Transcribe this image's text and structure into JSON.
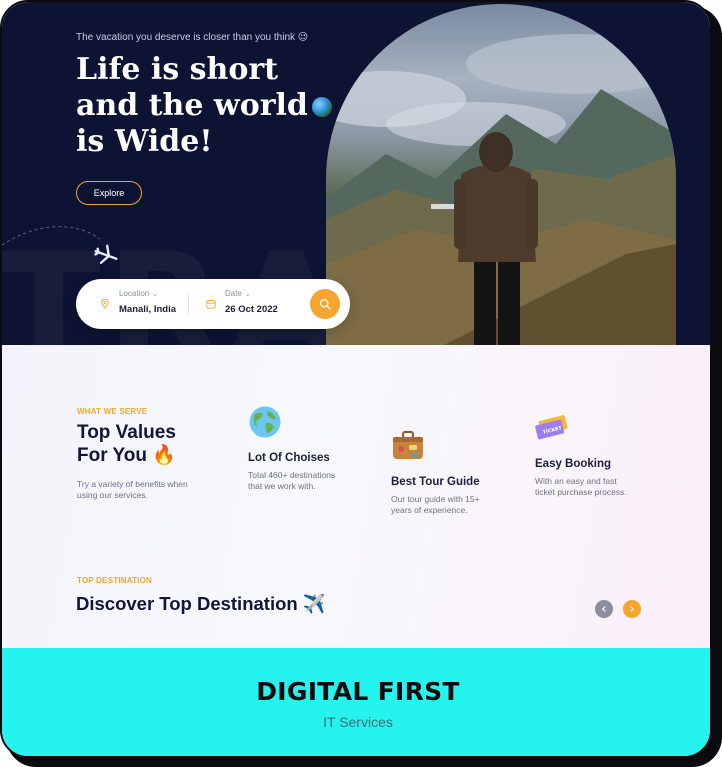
{
  "hero": {
    "tagline": "The vacation you deserve is closer than you think 😉",
    "title_line1": "Life is short",
    "title_line2": "and the world",
    "title_line3": "is Wide!",
    "background_word": "TRAVEL",
    "explore_label": "Explore"
  },
  "search": {
    "location_label": "Location",
    "location_value": "Manali, India",
    "date_label": "Date",
    "date_value": "26 Oct 2022"
  },
  "values": {
    "overline": "WHAT WE SERVE",
    "title_line1": "Top Values",
    "title_line2": "For You 🔥",
    "description": "Try a variety of benefits when using our services.",
    "features": [
      {
        "title": "Lot Of Choises",
        "description": "Total 460+ destinations that we work with.",
        "icon": "globe-icon"
      },
      {
        "title": "Best Tour Guide",
        "description": "Our tour guide with 15+ years of experience.",
        "icon": "suitcase-icon"
      },
      {
        "title": "Easy Booking",
        "description": "With an easy and fast ticket purchase process.",
        "icon": "ticket-icon"
      }
    ]
  },
  "destinations": {
    "overline": "TOP DESTINATION",
    "title": "Discover Top Destination ✈️"
  },
  "brand": {
    "name": "DIGITAL FIRST",
    "subtitle": "IT Services"
  },
  "colors": {
    "hero_bg": "#0d1333",
    "accent": "#f7a531",
    "brand_bg": "#25f4ee"
  }
}
